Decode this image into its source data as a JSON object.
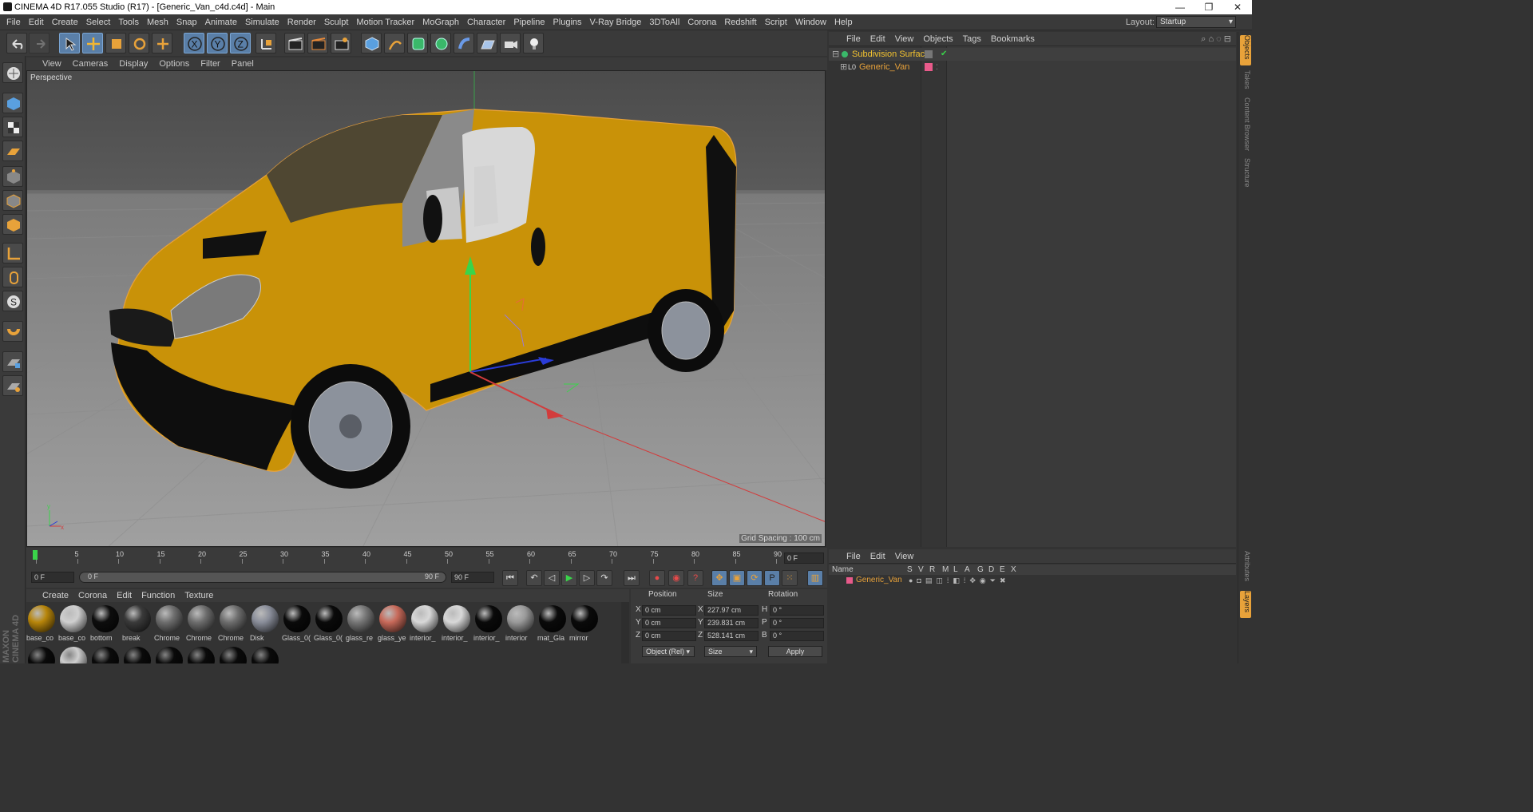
{
  "window": {
    "title": "CINEMA 4D R17.055 Studio (R17) - [Generic_Van_c4d.c4d] - Main",
    "minimize": "—",
    "restore": "❐",
    "close": "✕"
  },
  "menubar": {
    "items": [
      "File",
      "Edit",
      "Create",
      "Select",
      "Tools",
      "Mesh",
      "Snap",
      "Animate",
      "Simulate",
      "Render",
      "Sculpt",
      "Motion Tracker",
      "MoGraph",
      "Character",
      "Pipeline",
      "Plugins",
      "V-Ray Bridge",
      "3DToAll",
      "Corona",
      "Redshift",
      "Script",
      "Window",
      "Help"
    ],
    "layout_label": "Layout:",
    "layout_value": "Startup"
  },
  "viewport": {
    "menu": [
      "View",
      "Cameras",
      "Display",
      "Options",
      "Filter",
      "Panel"
    ],
    "label": "Perspective",
    "grid_spacing": "Grid Spacing : 100 cm"
  },
  "object_manager": {
    "menu": [
      "File",
      "Edit",
      "View",
      "Objects",
      "Tags",
      "Bookmarks"
    ],
    "objects": [
      {
        "name": "Subdivision Surface",
        "color": "#f2c230"
      },
      {
        "name": "Generic_Van",
        "color": "#e8a23a"
      }
    ]
  },
  "side_tabs": [
    "Objects",
    "Takes",
    "Content Browser",
    "Structure"
  ],
  "side_tabs_bottom": [
    "Attributes",
    "Layers"
  ],
  "layer_manager": {
    "menu": [
      "File",
      "Edit",
      "View"
    ],
    "columns": [
      "Name",
      "S",
      "V",
      "R",
      "M",
      "L",
      "A",
      "G",
      "D",
      "E",
      "X"
    ],
    "layers": [
      {
        "name": "Generic_Van",
        "color": "#e85a8a"
      }
    ]
  },
  "timeline": {
    "ticks": [
      "0",
      "5",
      "10",
      "15",
      "20",
      "25",
      "30",
      "35",
      "40",
      "45",
      "50",
      "55",
      "60",
      "65",
      "70",
      "75",
      "80",
      "85",
      "90"
    ],
    "current_frame": "0 F",
    "start_field": "0 F",
    "range_start": "0 F",
    "range_end": "90 F",
    "end_field": "90 F"
  },
  "materials": {
    "menu": [
      "Create",
      "Corona",
      "Edit",
      "Function",
      "Texture"
    ],
    "items": [
      {
        "name": "base_co",
        "color": "#b8860b"
      },
      {
        "name": "base_co",
        "color": "#cfcfcf"
      },
      {
        "name": "bottom",
        "color": "#0d0d0d"
      },
      {
        "name": "break",
        "color": "#3a3a3a"
      },
      {
        "name": "Chrome",
        "color": "#6e6e6e"
      },
      {
        "name": "Chrome",
        "color": "#6e6e6e"
      },
      {
        "name": "Chrome",
        "color": "#6e6e6e"
      },
      {
        "name": "Disk",
        "color": "#8a8e9a"
      },
      {
        "name": "Glass_0(",
        "color": "#0a0a0a"
      },
      {
        "name": "Glass_0(",
        "color": "#0a0a0a"
      },
      {
        "name": "glass_re",
        "color": "#777777"
      },
      {
        "name": "glass_ye",
        "color": "#c86a5a"
      },
      {
        "name": "interior_",
        "color": "#d8d8d8"
      },
      {
        "name": "interior_",
        "color": "#d8d8d8"
      },
      {
        "name": "interior_",
        "color": "#0a0a0a"
      },
      {
        "name": "interior",
        "color": "#9a9a9a"
      },
      {
        "name": "mat_Gla",
        "color": "#0a0a0a"
      },
      {
        "name": "mirror",
        "color": "#0a0a0a"
      }
    ]
  },
  "coordinates": {
    "headers": [
      "Position",
      "Size",
      "Rotation"
    ],
    "rows": [
      {
        "axis": "X",
        "pos": "0 cm",
        "size_axis": "X",
        "size": "227.97 cm",
        "rot_axis": "H",
        "rot": "0 °"
      },
      {
        "axis": "Y",
        "pos": "0 cm",
        "size_axis": "Y",
        "size": "239.831 cm",
        "rot_axis": "P",
        "rot": "0 °"
      },
      {
        "axis": "Z",
        "pos": "0 cm",
        "size_axis": "Z",
        "size": "528.141 cm",
        "rot_axis": "B",
        "rot": "0 °"
      }
    ],
    "mode": "Object (Rel)",
    "size_mode": "Size",
    "apply": "Apply"
  },
  "brand": "MAXON CINEMA 4D",
  "accent_color": "#e8a23a",
  "van_color": "#d39a0c"
}
